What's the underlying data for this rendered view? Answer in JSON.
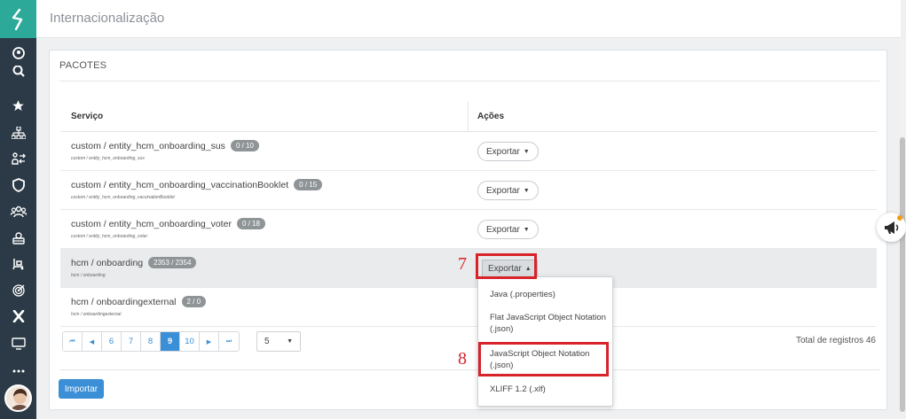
{
  "header": {
    "title": "Internacionalização"
  },
  "sidebar": {
    "icons": [
      "logo-icon",
      "user-circle-icon",
      "search-icon",
      "star-icon",
      "org-chart-icon",
      "people-transfer-icon",
      "shield-icon",
      "team-icon",
      "briefcase-icon",
      "handcart-icon",
      "target-icon",
      "x-icon",
      "monitor-icon",
      "more-icon"
    ]
  },
  "panel": {
    "title": "PACOTES",
    "columns": {
      "service": "Serviço",
      "actions": "Ações"
    },
    "rows": [
      {
        "service": "custom / entity_hcm_onboarding_sus",
        "badge": "0 / 10",
        "sub": "custom / entity_hcm_onboarding_sus",
        "action": "Exportar"
      },
      {
        "service": "custom / entity_hcm_onboarding_vaccinationBooklet",
        "badge": "0 / 15",
        "sub": "custom / entity_hcm_onboarding_vaccinationBooklet",
        "action": "Exportar"
      },
      {
        "service": "custom / entity_hcm_onboarding_voter",
        "badge": "0 / 18",
        "sub": "custom / entity_hcm_onboarding_voter",
        "action": "Exportar"
      },
      {
        "service": "hcm / onboarding",
        "badge": "2353 / 2354",
        "sub": "hcm / onboarding",
        "action": "Exportar"
      },
      {
        "service": "hcm / onboardingexternal",
        "badge": "2 / 0",
        "sub": "hcm / onboardingexternal",
        "action": ""
      }
    ],
    "pagination": {
      "first": "⏮",
      "prev": "◀",
      "pages": [
        "6",
        "7",
        "8",
        "9",
        "10"
      ],
      "current": "9",
      "next": "▶",
      "last": "⏭",
      "page_size": "5"
    },
    "total": "Total de registros 46",
    "import_label": "Importar"
  },
  "dropdown": {
    "items": [
      "Java (.properties)",
      "Flat JavaScript Object Notation (.json)",
      "JavaScript Object Notation (.json)",
      "XLIFF 1.2 (.xlf)"
    ]
  },
  "annotations": {
    "step7": "7",
    "step8": "8",
    "color": "#d8232a"
  },
  "colors": {
    "sidebar": "#2b3a46",
    "accent": "#2da99a",
    "primary": "#3a8fd6"
  }
}
